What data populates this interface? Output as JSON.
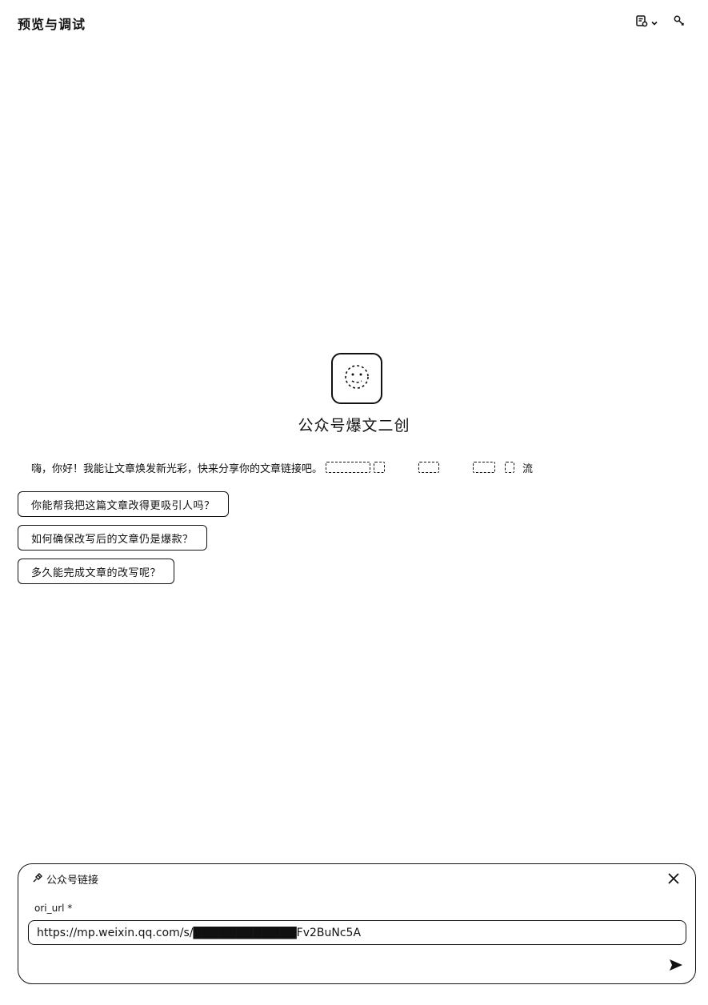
{
  "header": {
    "title": "预览与调试",
    "icons": {
      "history": "history-doc-icon",
      "dropdown": "chevron-down-icon",
      "settings": "wrench-icon"
    }
  },
  "bot": {
    "avatar_icon": "bot-avatar-icon",
    "name": "公众号爆文二创",
    "greeting_prefix": "嗨，你好！我能让文章焕发新光彩，快来分享你的文章链接吧。",
    "greeting_suffix": "流"
  },
  "suggestions": [
    "你能帮我把这篇文章改得更吸引人吗？",
    "如何确保改写后的文章仍是爆款？",
    "多久能完成文章的改写呢？"
  ],
  "input_panel": {
    "title": "公众号链接",
    "title_icon": "plugin-icon",
    "field_label": "ori_url *",
    "url_value": "https://mp.weixin.qq.com/s/████████████Fv2BuNc5A",
    "close_icon": "close-icon",
    "send_icon": "send-icon"
  }
}
